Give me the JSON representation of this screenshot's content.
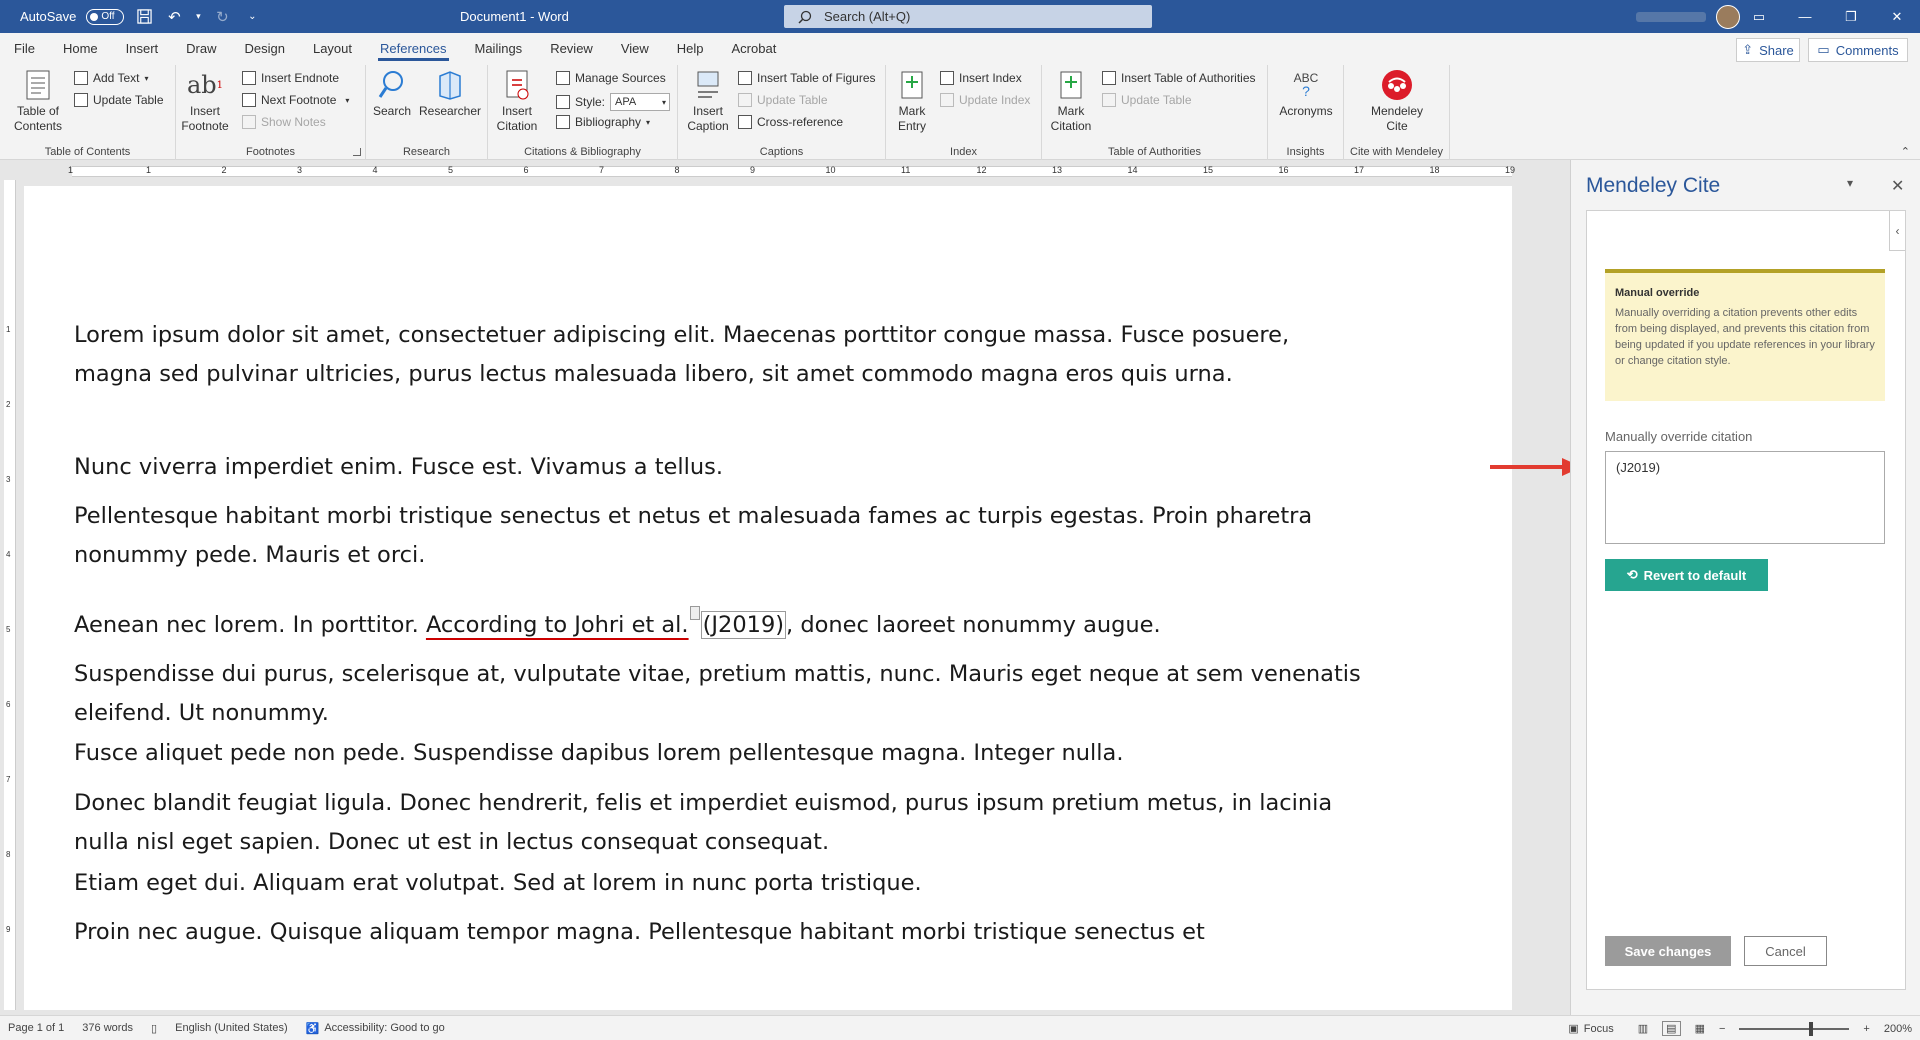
{
  "titlebar": {
    "autosave_label": "AutoSave",
    "autosave_state": "Off",
    "doc_title": "Document1 - Word",
    "search_placeholder": "Search (Alt+Q)"
  },
  "menu": {
    "tabs": [
      "File",
      "Home",
      "Insert",
      "Draw",
      "Design",
      "Layout",
      "References",
      "Mailings",
      "Review",
      "View",
      "Help",
      "Acrobat"
    ],
    "active": "References",
    "share": "Share",
    "comments": "Comments"
  },
  "ribbon": {
    "toc": {
      "big": "Table of Contents",
      "add_text": "Add Text",
      "update_table": "Update Table",
      "label": "Table of Contents"
    },
    "footnotes": {
      "big": "Insert Footnote",
      "insert_endnote": "Insert Endnote",
      "next_footnote": "Next Footnote",
      "show_notes": "Show Notes",
      "label": "Footnotes"
    },
    "research": {
      "search": "Search",
      "researcher": "Researcher",
      "label": "Research"
    },
    "citations": {
      "big": "Insert Citation",
      "manage_sources": "Manage Sources",
      "style_label": "Style:",
      "style_value": "APA",
      "bibliography": "Bibliography",
      "label": "Citations & Bibliography"
    },
    "captions": {
      "big": "Insert Caption",
      "insert_tof": "Insert Table of Figures",
      "update_table": "Update Table",
      "cross_ref": "Cross-reference",
      "label": "Captions"
    },
    "index": {
      "big": "Mark Entry",
      "insert_index": "Insert Index",
      "update_index": "Update Index",
      "label": "Index"
    },
    "toa": {
      "big": "Mark Citation",
      "insert_toa": "Insert Table of Authorities",
      "update_table": "Update Table",
      "label": "Table of Authorities"
    },
    "insights": {
      "acronyms": "Acronyms",
      "label": "Insights"
    },
    "mendeley": {
      "big": "Mendeley Cite",
      "label": "Cite with Mendeley"
    }
  },
  "ruler": {
    "numbers": [
      "1",
      "1",
      "2",
      "3",
      "4",
      "5",
      "6",
      "7",
      "8",
      "9",
      "10",
      "11",
      "12",
      "13",
      "14",
      "15",
      "16",
      "17",
      "18",
      "19"
    ]
  },
  "document": {
    "p1": "Lorem ipsum dolor sit amet, consectetuer adipiscing elit. Maecenas porttitor congue massa. Fusce posuere, magna sed pulvinar ultricies, purus lectus malesuada libero, sit amet commodo magna eros quis urna.",
    "p2": "Nunc viverra imperdiet enim. Fusce est. Vivamus a tellus.",
    "p3": "Pellentesque habitant morbi tristique senectus et netus et malesuada fames ac turpis egestas. Proin pharetra nonummy pede. Mauris et orci.",
    "p4_a": "Aenean nec lorem. In porttitor. ",
    "p4_underlined": "According to Johri et al.",
    "p4_cite": "(J2019)",
    "p4_b": ", donec laoreet nonummy augue.",
    "p5": "Suspendisse dui purus, scelerisque at, vulputate vitae, pretium mattis, nunc. Mauris eget neque at sem venenatis eleifend. Ut nonummy.",
    "p6": "Fusce aliquet pede non pede. Suspendisse dapibus lorem pellentesque magna. Integer nulla.",
    "p7": "Donec blandit feugiat ligula. Donec hendrerit, felis et imperdiet euismod, purus ipsum pretium metus, in lacinia nulla nisl eget sapien. Donec ut est in lectus consequat consequat.",
    "p8": "Etiam eget dui. Aliquam erat volutpat. Sed at lorem in nunc porta tristique.",
    "p9": "Proin nec augue. Quisque aliquam tempor magna. Pellentesque habitant morbi tristique senectus et"
  },
  "pane": {
    "title": "Mendeley Cite",
    "override_title": "Manual override",
    "override_text": "Manually overriding a citation prevents other edits from being displayed, and prevents this citation from being updated if you update references in your library or change citation style.",
    "input_label": "Manually override citation",
    "input_value": "(J2019)",
    "revert": "Revert to default",
    "save": "Save changes",
    "cancel": "Cancel"
  },
  "status": {
    "page": "Page 1 of 1",
    "words": "376 words",
    "language": "English (United States)",
    "accessibility": "Accessibility: Good to go",
    "focus": "Focus",
    "zoom": "200%"
  },
  "colors": {
    "brand": "#2b579a",
    "mendeley": "#dc1c2a",
    "revert": "#26a590",
    "arrow": "#e23b30"
  }
}
